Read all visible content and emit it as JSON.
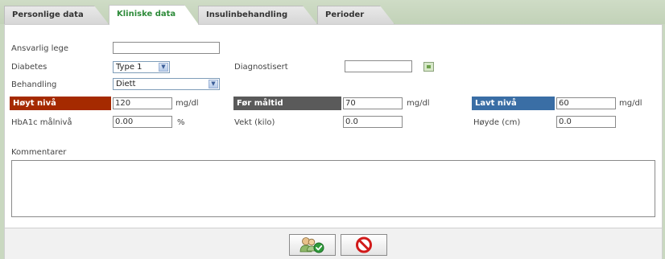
{
  "tabs": [
    {
      "label": "Personlige data",
      "active": false
    },
    {
      "label": "Kliniske data",
      "active": true
    },
    {
      "label": "Insulinbehandling",
      "active": false
    },
    {
      "label": "Perioder",
      "active": false
    }
  ],
  "form": {
    "responsible_doctor": {
      "label": "Ansvarlig lege",
      "value": ""
    },
    "diabetes": {
      "label": "Diabetes",
      "value": "Type 1"
    },
    "diagnosed": {
      "label": "Diagnostisert",
      "value": ""
    },
    "treatment": {
      "label": "Behandling",
      "value": "Diett"
    },
    "high_level": {
      "label": "Høyt nivå",
      "value": "120",
      "unit": "mg/dl",
      "color": "#a52a00"
    },
    "before_meal": {
      "label": "Før måltid",
      "value": "70",
      "unit": "mg/dl",
      "color": "#5a5a5a"
    },
    "low_level": {
      "label": "Lavt nivå",
      "value": "60",
      "unit": "mg/dl",
      "color": "#3a6ea5"
    },
    "hba1c": {
      "label": "HbA1c målnivå",
      "value": "0.00",
      "unit": "%"
    },
    "weight": {
      "label": "Vekt (kilo)",
      "value": "0.0"
    },
    "height": {
      "label": "Høyde (cm)",
      "value": "0.0"
    },
    "comments": {
      "label": "Kommentarer",
      "value": ""
    }
  },
  "icons": {
    "save": "save-users-check-icon",
    "cancel": "cancel-no-icon",
    "calendar": "calendar-icon"
  }
}
